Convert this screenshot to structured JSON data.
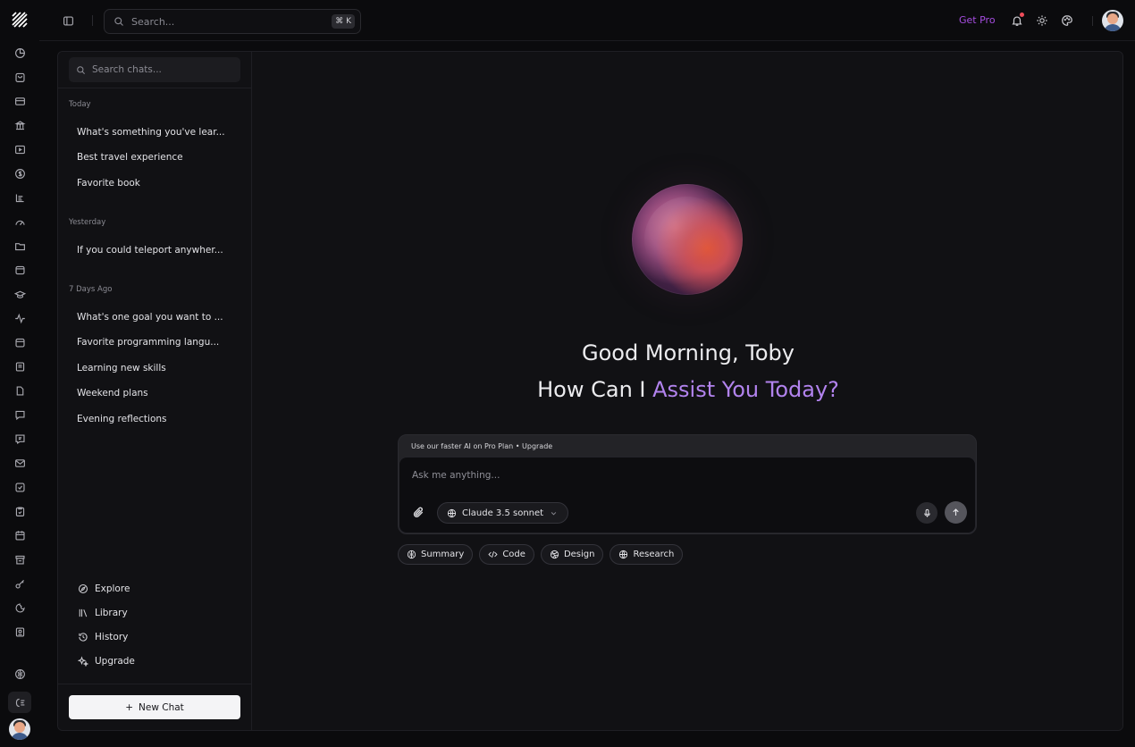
{
  "topbar": {
    "search_placeholder": "Search...",
    "shortcut": "⌘ K",
    "get_pro": "Get Pro"
  },
  "sidebar": {
    "search_placeholder": "Search chats...",
    "groups": {
      "today": {
        "label": "Today",
        "items": [
          "What's something you've lear...",
          "Best travel experience",
          "Favorite book"
        ]
      },
      "yesterday": {
        "label": "Yesterday",
        "items": [
          "If you could teleport anywher..."
        ]
      },
      "week": {
        "label": "7 Days Ago",
        "items": [
          "What's one goal you want to ...",
          "Favorite programming langu...",
          "Learning new skills",
          "Weekend plans",
          "Evening reflections"
        ]
      }
    },
    "nav": {
      "explore": "Explore",
      "library": "Library",
      "history": "History",
      "upgrade": "Upgrade"
    },
    "new_chat": "New Chat"
  },
  "main": {
    "greeting_line1": "Good Morning, Toby",
    "greeting_prefix": "How Can I ",
    "greeting_accent": "Assist You Today?",
    "promo": "Use our faster AI on Pro Plan  •  Upgrade",
    "input_placeholder": "Ask me anything...",
    "model": "Claude 3.5 sonnet",
    "chips": [
      "Summary",
      "Code",
      "Design",
      "Research"
    ]
  },
  "colors": {
    "accent": "#b283ee",
    "get_pro": "#a64de0",
    "notification": "#ef4d5a"
  }
}
